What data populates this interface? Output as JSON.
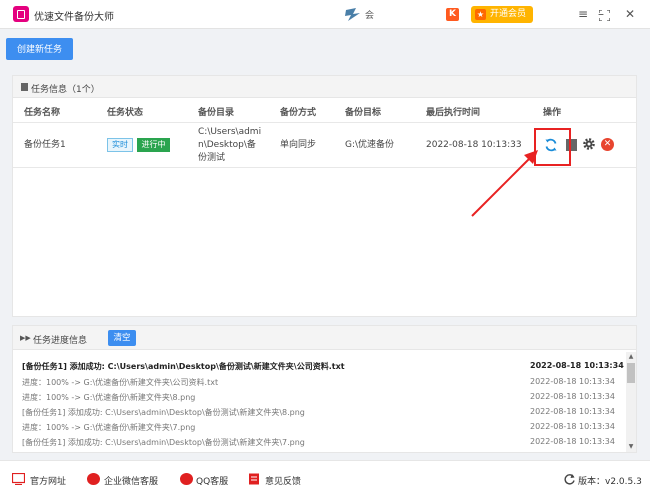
{
  "app": {
    "title": "优速文件备份大师",
    "partner_text": "会",
    "vip_label": "开通会员",
    "badge": "K"
  },
  "toolbar": {
    "new_task_label": "创建新任务"
  },
  "task_panel": {
    "title": "任务信息（1个）",
    "columns": [
      "任务名称",
      "任务状态",
      "备份目录",
      "备份方式",
      "备份目标",
      "最后执行时间",
      "操作"
    ],
    "rows": [
      {
        "name": "备份任务1",
        "mode_tag": "实时",
        "status_tag": "进行中",
        "source": [
          "C:\\Users\\admi",
          "n\\Desktop\\备",
          "份测试"
        ],
        "method": "单向同步",
        "target": "G:\\优速备份",
        "last_run": "2022-08-18 10:13:33"
      }
    ]
  },
  "progress_panel": {
    "title": "任务进度信息",
    "clear_label": "清空",
    "logs": [
      {
        "text": "[备份任务1] 添加成功:  C:\\Users\\admin\\Desktop\\备份测试\\新建文件夹\\公司资料.txt",
        "time": "2022-08-18 10:13:34",
        "bold": true
      },
      {
        "text": "进度：100% -> G:\\优速备份\\新建文件夹\\公司资料.txt",
        "time": "2022-08-18 10:13:34",
        "bold": false
      },
      {
        "text": "进度：100% -> G:\\优速备份\\新建文件夹\\8.png",
        "time": "2022-08-18 10:13:34",
        "bold": false
      },
      {
        "text": "[备份任务1] 添加成功:  C:\\Users\\admin\\Desktop\\备份测试\\新建文件夹\\8.png",
        "time": "2022-08-18 10:13:34",
        "bold": false
      },
      {
        "text": "进度：100% -> G:\\优速备份\\新建文件夹\\7.png",
        "time": "2022-08-18 10:13:34",
        "bold": false
      },
      {
        "text": "[备份任务1] 添加成功:  C:\\Users\\admin\\Desktop\\备份测试\\新建文件夹\\7.png",
        "time": "2022-08-18 10:13:34",
        "bold": false
      }
    ]
  },
  "footer": {
    "website": "官方网址",
    "wechat": "企业微信客服",
    "qq": "QQ客服",
    "feedback": "意见反馈",
    "version": "版本：v2.0.5.3"
  },
  "colors": {
    "accent": "#3d8ef0",
    "running": "#2aa44f",
    "danger": "#e8452f",
    "vip": "#ffb400",
    "brand": "#e4007f"
  }
}
